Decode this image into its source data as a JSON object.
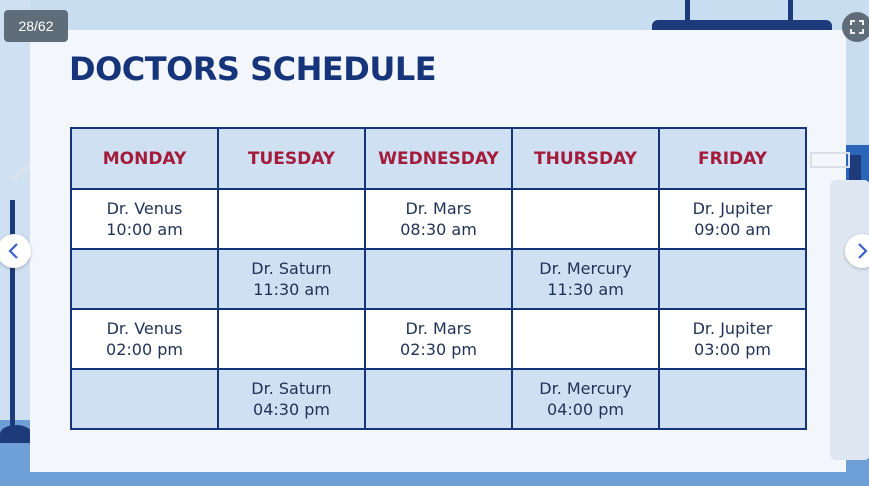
{
  "viewer": {
    "slide_counter": "28/62",
    "fullscreen_icon": "fullscreen-icon",
    "prev_icon": "chevron-left-icon",
    "next_icon": "chevron-right-icon"
  },
  "slide": {
    "title": "DOCTORS SCHEDULE",
    "columns": [
      "MONDAY",
      "TUESDAY",
      "WEDNESDAY",
      "THURSDAY",
      "FRIDAY"
    ],
    "rows": [
      [
        [
          "Dr. Venus",
          "10:00 am"
        ],
        [
          "",
          ""
        ],
        [
          "Dr. Mars",
          "08:30 am"
        ],
        [
          "",
          ""
        ],
        [
          "Dr. Jupiter",
          "09:00 am"
        ]
      ],
      [
        [
          "",
          ""
        ],
        [
          "Dr. Saturn",
          "11:30 am"
        ],
        [
          "",
          ""
        ],
        [
          "Dr. Mercury",
          "11:30 am"
        ],
        [
          "",
          ""
        ]
      ],
      [
        [
          "Dr. Venus",
          "02:00 pm"
        ],
        [
          "",
          ""
        ],
        [
          "Dr. Mars",
          "02:30 pm"
        ],
        [
          "",
          ""
        ],
        [
          "Dr. Jupiter",
          "03:00 pm"
        ]
      ],
      [
        [
          "",
          ""
        ],
        [
          "Dr. Saturn",
          "04:30 pm"
        ],
        [
          "",
          ""
        ],
        [
          "Dr. Mercury",
          "04:00 pm"
        ],
        [
          "",
          ""
        ]
      ]
    ]
  },
  "colors": {
    "title": "#16347a",
    "header_text": "#a31c3b",
    "header_bg": "#cfe0f2",
    "border": "#16347a"
  }
}
